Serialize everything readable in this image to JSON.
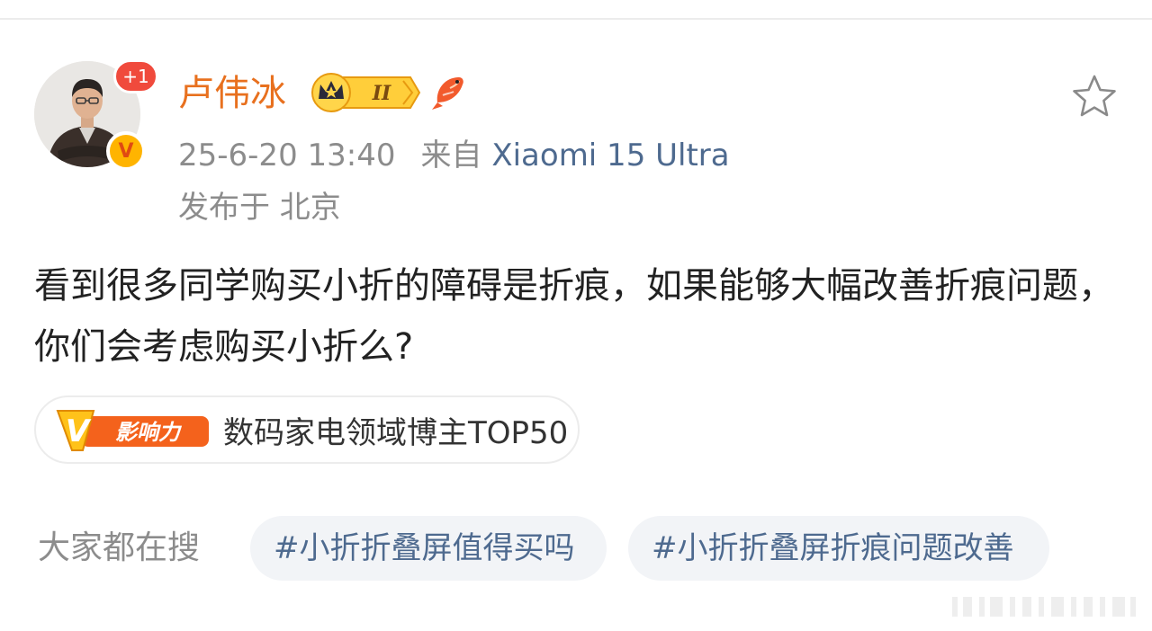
{
  "post": {
    "author": {
      "name": "卢伟冰",
      "follow_badge": "+1",
      "verified_badge": "V",
      "member_level": "II"
    },
    "time": "25-6-20 13:40",
    "source_prefix": "来自",
    "device": "Xiaomi 15 Ultra",
    "location": "发布于 北京",
    "text": "看到很多同学购买小折的障碍是折痕，如果能够大幅改善折痕问题，你们会考虑购买小折么?",
    "influence": {
      "badge_label": "影响力",
      "badge_letter": "V",
      "text": "数码家电领域博主TOP50"
    }
  },
  "search": {
    "label": "大家都在搜",
    "tags": [
      "#小折折叠屏值得买吗",
      "#小折折叠屏折痕问题改善"
    ]
  },
  "icons": {
    "favorite": "star-outline-icon",
    "member": "crown-member-badge-icon",
    "fan": "koi-fish-icon"
  },
  "colors": {
    "username": "#e8701e",
    "link": "#4e6a8f",
    "meta": "#8c8c8c",
    "badge_red": "#f04a3c",
    "badge_gold": "#ffb400"
  }
}
